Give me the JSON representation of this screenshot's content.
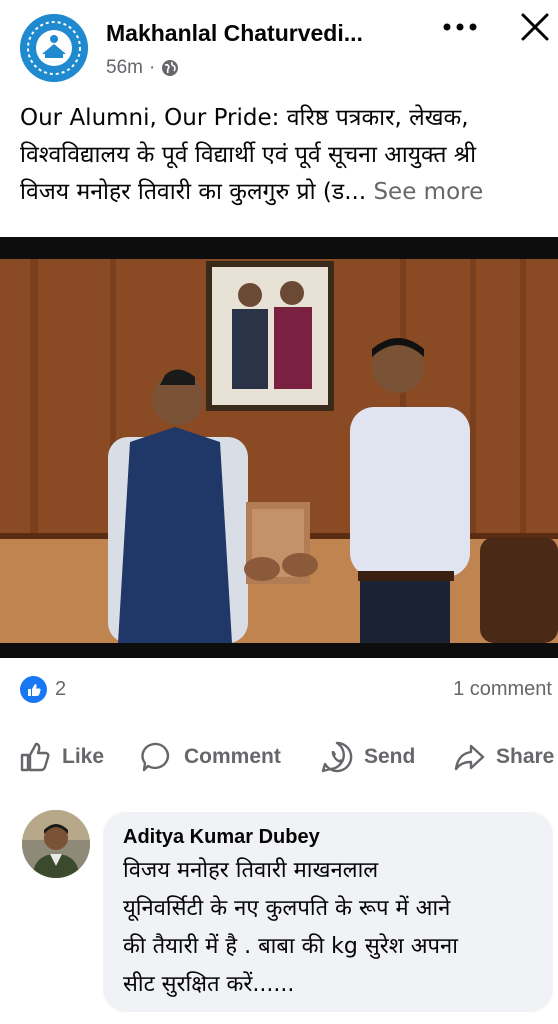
{
  "post": {
    "page_name": "Makhanlal Chaturvedi...",
    "time": "56m",
    "audience_icon": "globe-icon",
    "text_lines": [
      "Our Alumni, Our Pride: वरिष्ठ पत्रकार, लेखक,",
      "विश्वविद्यालय के पूर्व विद्यार्थी एवं पूर्व सूचना आयुक्त श्री",
      "विजय मनोहर तिवारी का कुलगुरु प्रो (ड..."
    ],
    "see_more": "See more",
    "photo_description": "photo"
  },
  "engagement": {
    "reaction_icon": "like-icon",
    "reaction_count": "2",
    "comment_count": "1 comment"
  },
  "actions": {
    "like": "Like",
    "comment": "Comment",
    "send": "Send",
    "share": "Share"
  },
  "comment": {
    "author": "Aditya Kumar Dubey",
    "text_lines": [
      "विजय मनोहर तिवारी माखनलाल",
      "यूनिवर्सिटी के नए कुलपति के रूप में आने",
      "की तैयारी में है . बाबा की kg सुरेश अपना",
      "सीट सुरक्षित करें......"
    ]
  },
  "colors": {
    "accent": "#1877f2",
    "secondary_text": "#65676b",
    "bubble": "#f0f2f5"
  }
}
